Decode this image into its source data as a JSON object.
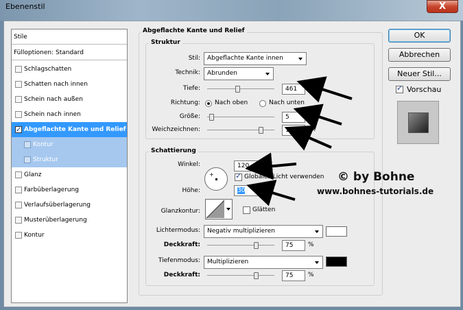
{
  "window": {
    "title": "Ebenenstil",
    "close_glyph": "X"
  },
  "styles_list": {
    "header": "Stile",
    "fill_options": "Fülloptionen: Standard",
    "items": [
      {
        "label": "Schlagschatten",
        "checked": false
      },
      {
        "label": "Schatten nach innen",
        "checked": false
      },
      {
        "label": "Schein nach außen",
        "checked": false
      },
      {
        "label": "Schein nach innen",
        "checked": false
      },
      {
        "label": "Abgeflachte Kante und Relief",
        "checked": true
      },
      {
        "label": "Kontur",
        "checked": false
      },
      {
        "label": "Struktur",
        "checked": false
      },
      {
        "label": "Glanz",
        "checked": false
      },
      {
        "label": "Farbüberlagerung",
        "checked": false
      },
      {
        "label": "Verlaufsüberlagerung",
        "checked": false
      },
      {
        "label": "Musterüberlagerung",
        "checked": false
      },
      {
        "label": "Kontur",
        "checked": false
      }
    ]
  },
  "main": {
    "title": "Abgeflachte Kante und Relief",
    "structure": {
      "legend": "Struktur",
      "style_label": "Stil:",
      "style_value": "Abgeflachte Kante innen",
      "technique_label": "Technik:",
      "technique_value": "Abrunden",
      "depth_label": "Tiefe:",
      "depth_value": "461",
      "depth_unit": "%",
      "depth_fraction": 0.45,
      "direction_label": "Richtung:",
      "direction_up": "Nach oben",
      "direction_down": "Nach unten",
      "direction_selected": "Nach oben",
      "size_label": "Größe:",
      "size_value": "5",
      "size_unit": "Px",
      "size_fraction": 0.03,
      "soften_label": "Weichzeichnen:",
      "soften_value": "13",
      "soften_unit": "Px",
      "soften_fraction": 0.82
    },
    "shading": {
      "legend": "Schattierung",
      "angle_label": "Winkel:",
      "angle_value": "120",
      "angle_unit": "°",
      "global_light_label": "Globales Licht verwenden",
      "global_light_checked": true,
      "altitude_label": "Höhe:",
      "altitude_value": "30",
      "altitude_unit": "°",
      "gloss_contour_label": "Glanzkontur:",
      "antialias_label": "Glätten",
      "antialias_checked": false,
      "highlight_mode_label": "Lichtermodus:",
      "highlight_mode_value": "Negativ multiplizieren",
      "highlight_color": "#ffffff",
      "highlight_opacity_label": "Deckkraft:",
      "highlight_opacity_value": "75",
      "highlight_opacity_unit": "%",
      "highlight_opacity_fraction": 0.75,
      "shadow_mode_label": "Tiefenmodus:",
      "shadow_mode_value": "Multiplizieren",
      "shadow_color": "#000000",
      "shadow_opacity_label": "Deckkraft:",
      "shadow_opacity_value": "75",
      "shadow_opacity_unit": "%",
      "shadow_opacity_fraction": 0.75
    }
  },
  "buttons": {
    "ok": "OK",
    "cancel": "Abbrechen",
    "new_style": "Neuer Stil...",
    "preview_label": "Vorschau",
    "preview_checked": true
  },
  "watermark": {
    "line1": "© by Bohne",
    "line2": "www.bohnes-tutorials.de"
  },
  "colors": {
    "selection": "#3399ff",
    "sub_selection": "#a6c8ef",
    "arrow": "#000000"
  }
}
